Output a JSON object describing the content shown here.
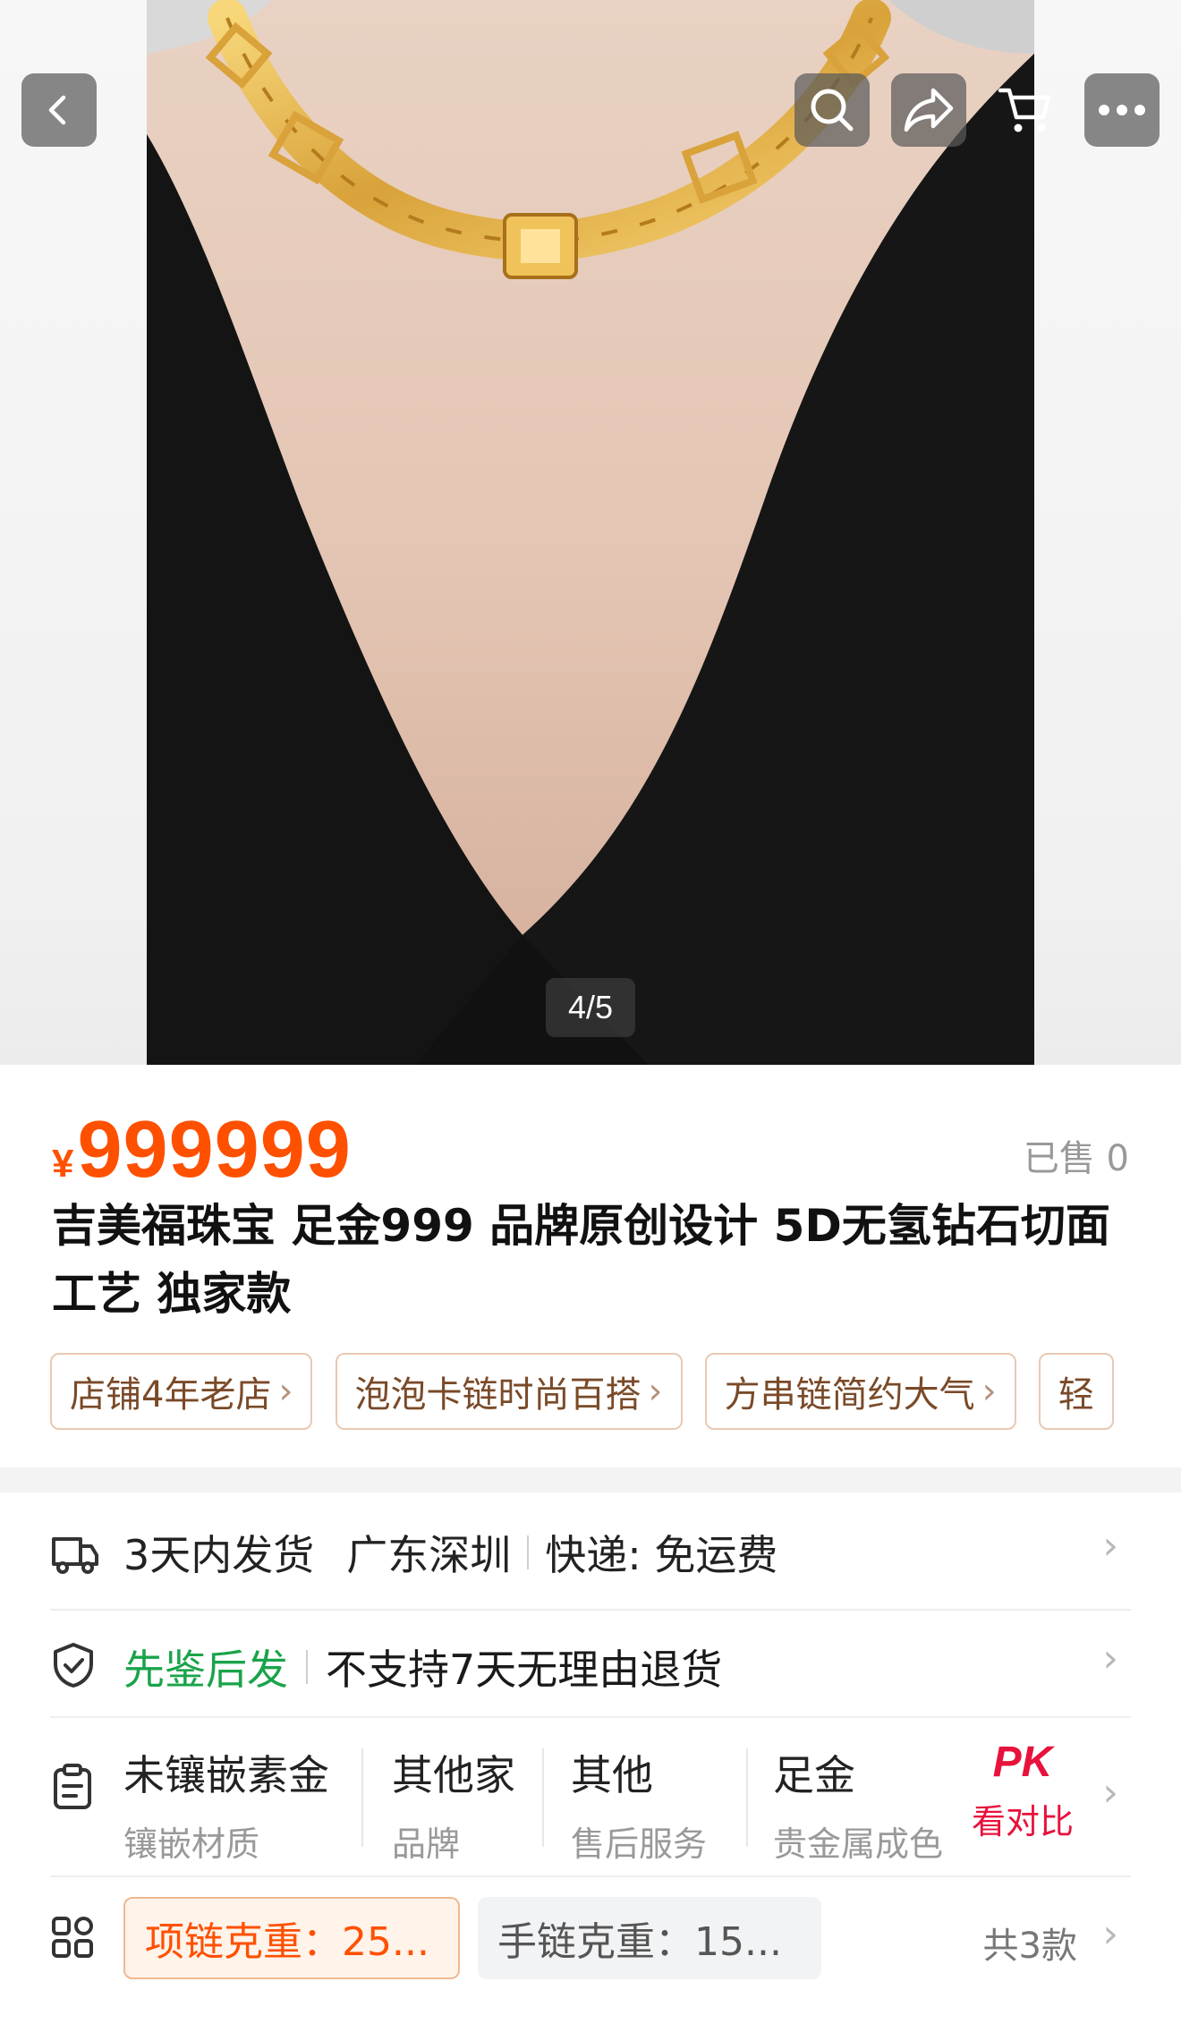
{
  "gallery": {
    "counter": "4/5",
    "current_image": 4,
    "total_images": 5
  },
  "nav": {
    "back_icon": "chevron-left-icon",
    "search_icon": "search-icon",
    "share_icon": "share-icon",
    "cart_icon": "cart-icon",
    "more_icon": "more-icon"
  },
  "product": {
    "currency": "¥",
    "price": "999999",
    "sold": "已售 0",
    "title": "吉美福珠宝 足金999 品牌原创设计 5D无氢钻石切面工艺 独家款",
    "tags": [
      "店铺4年老店",
      "泡泡卡链时尚百搭",
      "方串链简约大气",
      "轻"
    ]
  },
  "shipping": {
    "delivery": "3天内发货",
    "location": "广东深圳",
    "express": "快递: 免运费"
  },
  "guarantee": {
    "highlight": "先鉴后发",
    "text": "不支持7天无理由退货"
  },
  "attributes": [
    {
      "value": "未镶嵌素金",
      "key": "镶嵌材质"
    },
    {
      "value": "其他家",
      "key": "品牌"
    },
    {
      "value": "其他",
      "key": "售后服务"
    },
    {
      "value": "足金",
      "key": "贵金属成色"
    }
  ],
  "compare": {
    "badge": "PK",
    "label": "看对比"
  },
  "variants": {
    "options": [
      "项链克重：25...",
      "手链克重：15..."
    ],
    "selected_index": 0,
    "count": "共3款"
  },
  "colors": {
    "price": "#ff5000",
    "green": "#1aa34a",
    "pk": "#e8123c"
  }
}
